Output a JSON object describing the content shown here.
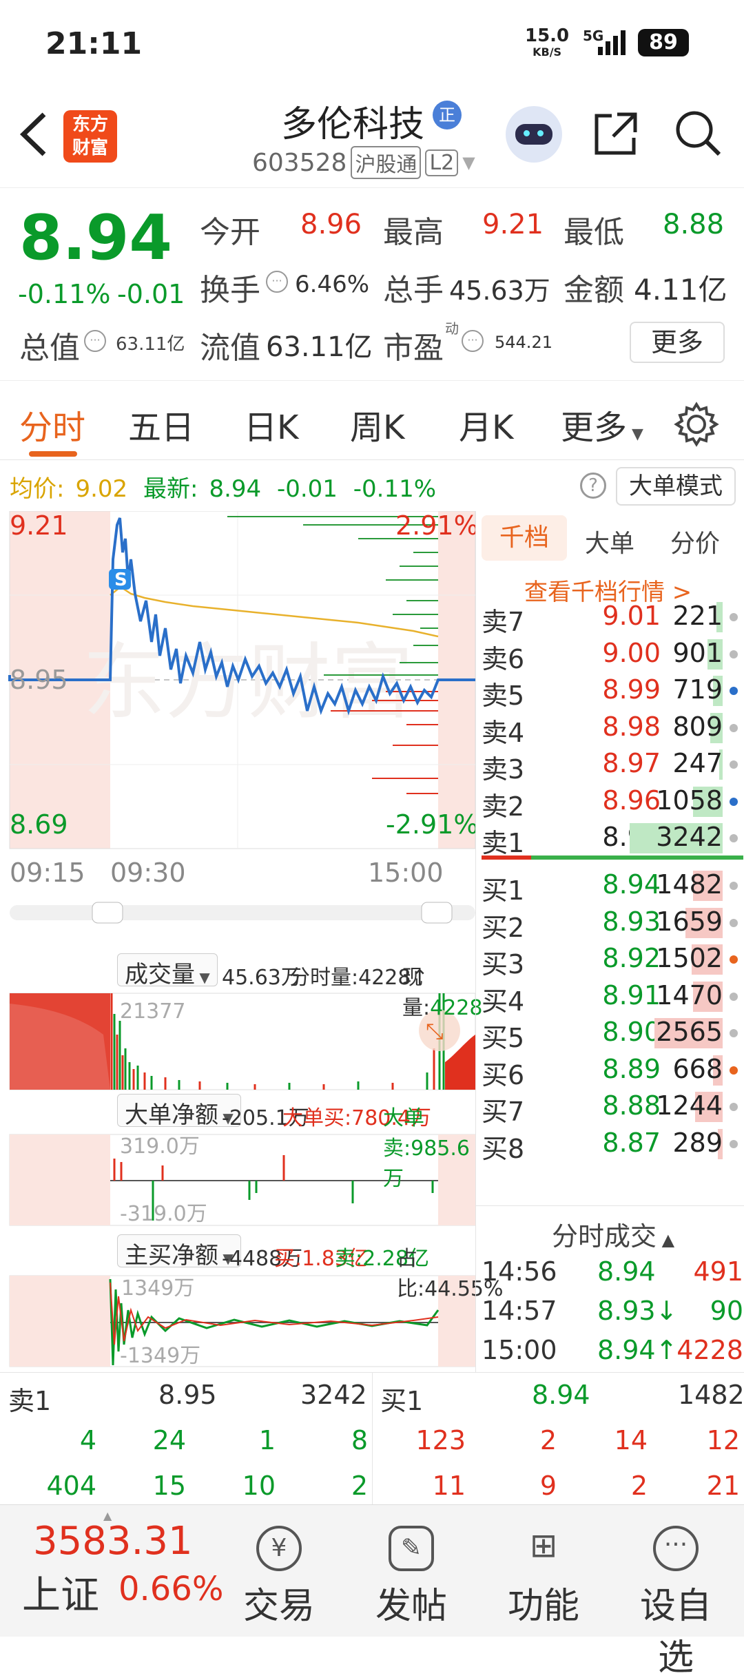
{
  "status": {
    "time": "21:11",
    "speed": "15.0",
    "speed_unit": "KB/S",
    "network": "5G",
    "battery": "89"
  },
  "header": {
    "logo_top": "东方",
    "logo_bottom": "财富",
    "name": "多伦科技",
    "badge": "正",
    "code": "603528",
    "tag1": "沪股通",
    "tag2": "L2"
  },
  "quote": {
    "price": "8.94",
    "change_pct": "-0.11%",
    "change": "-0.01",
    "open_label": "今开",
    "open": "8.96",
    "high_label": "最高",
    "high": "9.21",
    "low_label": "最低",
    "low": "8.88",
    "turnover_label": "换手",
    "turnover": "6.46%",
    "volume_label": "总手",
    "volume": "45.63万",
    "amount_label": "金额",
    "amount": "4.11亿",
    "mcap_label": "总值",
    "mcap": "63.11亿",
    "float_label": "流值",
    "float": "63.11亿",
    "pe_label": "市盈",
    "pe_sup": "动",
    "pe": "544.21",
    "more": "更多"
  },
  "tabs": [
    "分时",
    "五日",
    "日K",
    "周K",
    "月K",
    "更多"
  ],
  "avg": {
    "avg_label": "均价:",
    "avg": "9.02",
    "last_label": "最新:",
    "last": "8.94",
    "chg": "-0.01",
    "pct": "-0.11%",
    "mode": "大单模式"
  },
  "chart": {
    "y_top": "9.21",
    "y_mid": "8.95",
    "y_bot": "8.69",
    "pct_top": "2.91%",
    "pct_bot": "-2.91%",
    "t1": "09:15",
    "t2": "09:30",
    "t3": "15:00",
    "marker": "S",
    "watermark": "东方财富",
    "vol": {
      "label": "成交量",
      "total": "45.63万",
      "fen": "分时量:4228↑",
      "now_label": "现量:",
      "now": "4228",
      "max": "21377"
    },
    "big": {
      "label": "大单净额",
      "net": "-205.1万",
      "buy": "大单买:780.4万",
      "sell": "大单卖:985.6万",
      "top": "319.0万",
      "bot": "-319.0万"
    },
    "main": {
      "label": "主买净额",
      "net": "-4488万",
      "buy": "买:1.83亿",
      "sell": "卖:2.28亿",
      "ratio": "占比:44.55%",
      "top": "1349万",
      "bot": "-1349万"
    }
  },
  "orderbook": {
    "tabs": [
      "千档",
      "大单",
      "分价"
    ],
    "link": "查看千档行情 >",
    "sells": [
      {
        "label": "卖7",
        "price": "9.01",
        "vol": "221",
        "frac": 0.05
      },
      {
        "label": "卖6",
        "price": "9.00",
        "vol": "901",
        "frac": 0.12
      },
      {
        "label": "卖5",
        "price": "8.99",
        "vol": "719",
        "frac": 0.08
      },
      {
        "label": "卖4",
        "price": "8.98",
        "vol": "809",
        "frac": 0.1
      },
      {
        "label": "卖3",
        "price": "8.97",
        "vol": "247",
        "frac": 0.03
      },
      {
        "label": "卖2",
        "price": "8.96",
        "vol": "1058",
        "frac": 0.24
      },
      {
        "label": "卖1",
        "price": "8.95",
        "vol": "3242",
        "frac": 0.75
      }
    ],
    "buys": [
      {
        "label": "买1",
        "price": "8.94",
        "vol": "1482",
        "frac": 0.24
      },
      {
        "label": "买2",
        "price": "8.93",
        "vol": "1659",
        "frac": 0.3
      },
      {
        "label": "买3",
        "price": "8.92",
        "vol": "1502",
        "frac": 0.25
      },
      {
        "label": "买4",
        "price": "8.91",
        "vol": "1470",
        "frac": 0.24
      },
      {
        "label": "买5",
        "price": "8.90",
        "vol": "2565",
        "frac": 0.55
      },
      {
        "label": "买6",
        "price": "8.89",
        "vol": "668",
        "frac": 0.08
      },
      {
        "label": "买7",
        "price": "8.88",
        "vol": "1244",
        "frac": 0.22
      },
      {
        "label": "买8",
        "price": "8.87",
        "vol": "289",
        "frac": 0.04
      }
    ],
    "trades_label": "分时成交",
    "trades": [
      {
        "t": "14:56",
        "p": "8.94",
        "v": "491"
      },
      {
        "t": "14:57",
        "p": "8.93↓",
        "v": "90"
      },
      {
        "t": "15:00",
        "p": "8.94↑",
        "v": "4228"
      }
    ]
  },
  "bottomquote": {
    "sell_label": "卖1",
    "sell_price": "8.95",
    "sell_vol": "3242",
    "buy_label": "买1",
    "buy_price": "8.94",
    "buy_vol": "1482",
    "row1_left": [
      "4",
      "24",
      "1",
      "8"
    ],
    "row1_right": [
      "123",
      "2",
      "14",
      "12"
    ],
    "row2_left": [
      "404",
      "15",
      "10",
      "2"
    ],
    "row2_right": [
      "11",
      "9",
      "2",
      "21"
    ]
  },
  "footer": {
    "index": "3583.31",
    "index_name": "上证",
    "index_pct": "0.66%",
    "trade": "交易",
    "post": "发帖",
    "func": "功能",
    "watch": "设自选"
  },
  "colors": {
    "red": "#e0301e",
    "green": "#0a9a2a",
    "line": "#2a6fc9",
    "avg": "#e8b12c"
  }
}
